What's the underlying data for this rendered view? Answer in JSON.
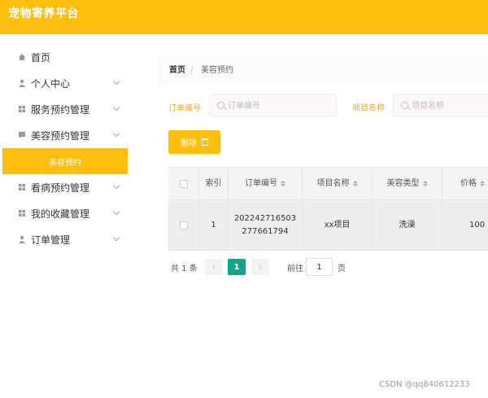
{
  "app": {
    "title": "宠物寄养平台"
  },
  "colors": {
    "accent": "#fdbe0e",
    "pagination_active": "#1aa38b",
    "label": "#f5a623"
  },
  "sidebar": {
    "items": [
      {
        "label": "首页",
        "icon": "home-icon"
      },
      {
        "label": "个人中心",
        "icon": "user-icon"
      },
      {
        "label": "服务预约管理",
        "icon": "grid-icon"
      },
      {
        "label": "美容预约管理",
        "icon": "chat-icon"
      },
      {
        "label": "看病预约管理",
        "icon": "grid-icon"
      },
      {
        "label": "我的收藏管理",
        "icon": "grid-icon"
      },
      {
        "label": "订单管理",
        "icon": "user-icon"
      }
    ],
    "active_sub": "美容预约"
  },
  "breadcrumb": {
    "home": "首页",
    "separator": "/",
    "current": "美容预约"
  },
  "search": {
    "order_label": "订单编号",
    "order_placeholder": "订单编号",
    "project_label": "项目名称",
    "project_placeholder": "项目名称"
  },
  "toolbar": {
    "delete_label": "删除"
  },
  "table": {
    "headers": [
      "索引",
      "订单编号",
      "项目名称",
      "美容类型",
      "价格"
    ],
    "rows": [
      {
        "index": "1",
        "order_no_1": "202242716503",
        "order_no_2": "277661794",
        "project": "xx项目",
        "type": "洗澡",
        "price": "100"
      }
    ]
  },
  "pagination": {
    "total": "共 1 条",
    "prev": "‹",
    "current": "1",
    "next": "›",
    "goto": "前往",
    "goto_value": "1",
    "unit": "页"
  },
  "watermark": "CSDN @qq840612233"
}
